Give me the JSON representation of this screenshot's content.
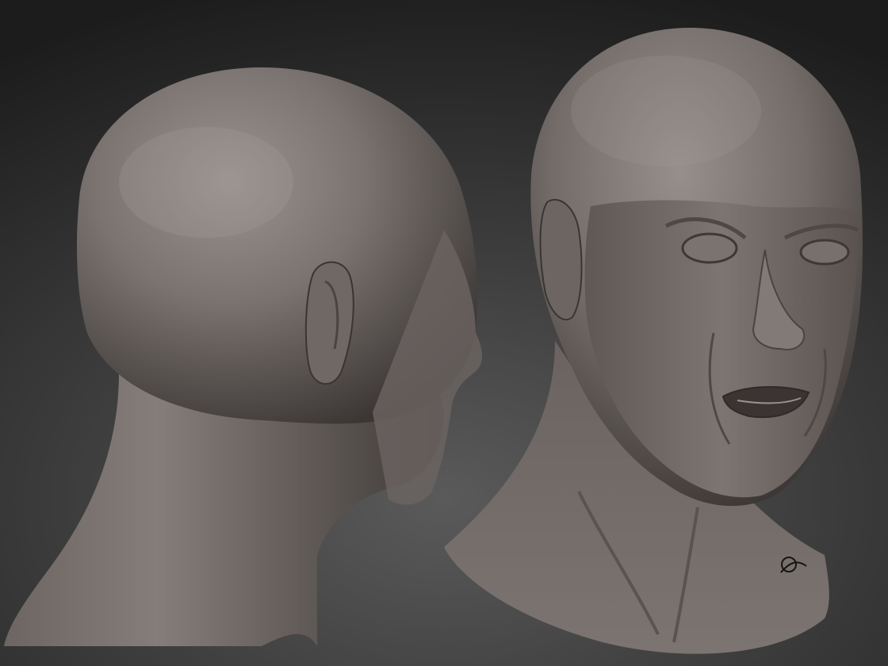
{
  "scene": {
    "subject": "bald-head-sculpt",
    "views": [
      "back-three-quarter",
      "front-three-quarter"
    ],
    "colors": {
      "background_dark": "#1c1c1c",
      "background_light": "#5a5a5a",
      "clay_light": "#8a8380",
      "clay_mid": "#6e6764",
      "clay_dark": "#3a3533"
    },
    "signature": "signature-mark"
  }
}
